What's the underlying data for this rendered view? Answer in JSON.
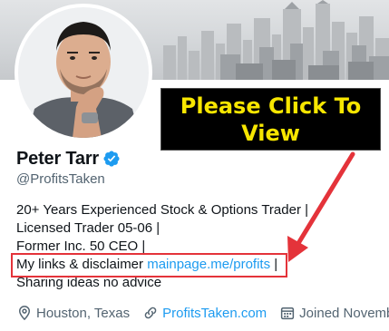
{
  "profile": {
    "display_name": "Peter Tarr",
    "handle": "@ProfitsTaken",
    "verified_icon": "verified-badge-icon",
    "bio": {
      "line1": "20+ Years Experienced Stock & Options Trader |",
      "line2": "Licensed Trader 05-06 |",
      "line3": "Former Inc. 50 CEO |",
      "line4_text": "My links & disclaimer ",
      "line4_link": "mainpage.me/profits",
      "line4_suffix": " |",
      "line5": "Sharing ideas no advice"
    },
    "meta": {
      "location": "Houston, Texas",
      "website": "ProfitsTaken.com",
      "joined": "Joined November"
    }
  },
  "annotation": {
    "cta_line1": "Please Click To",
    "cta_line2": "View"
  },
  "colors": {
    "link": "#1d9bf0",
    "secondary_text": "#536471",
    "primary_text": "#0f1419",
    "cta_text": "#f7e600",
    "cta_bg": "#000000",
    "highlight": "#e4333a",
    "verified": "#1d9bf0"
  },
  "icons": {
    "location": "location-pin-icon",
    "website": "link-icon",
    "joined": "calendar-icon",
    "arrow": "red-arrow-icon"
  }
}
